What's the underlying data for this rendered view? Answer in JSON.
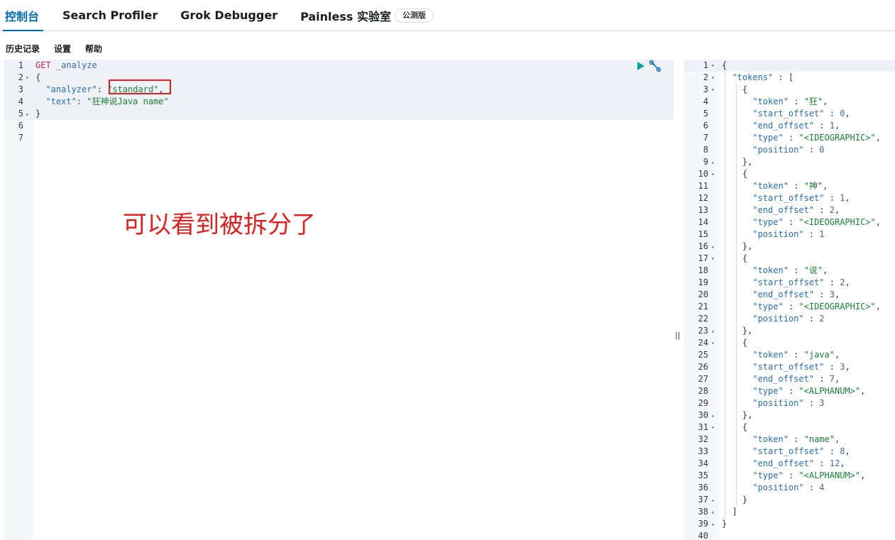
{
  "tabs": [
    {
      "label": "控制台",
      "active": true
    },
    {
      "label": "Search Profiler"
    },
    {
      "label": "Grok Debugger"
    },
    {
      "label": "Painless 实验室",
      "badge": "公测版"
    }
  ],
  "submenu": [
    "历史记录",
    "设置",
    "帮助"
  ],
  "request": {
    "lines": [
      {
        "n": "1",
        "fold": ""
      },
      {
        "n": "2",
        "fold": "▾"
      },
      {
        "n": "3",
        "fold": ""
      },
      {
        "n": "4",
        "fold": ""
      },
      {
        "n": "5",
        "fold": "▴"
      },
      {
        "n": "6",
        "fold": ""
      },
      {
        "n": "7",
        "fold": ""
      }
    ],
    "method": "GET",
    "endpoint": "_analyze",
    "analyzer_key": "\"analyzer\"",
    "analyzer_value": "\"standard\"",
    "text_key": "\"text\"",
    "text_value": "\"狂神说Java name\""
  },
  "annotation": "可以看到被拆分了",
  "response": {
    "tokens": [
      {
        "token": "\"狂\"",
        "start_offset": "0",
        "end_offset": "1",
        "type": "\"<IDEOGRAPHIC>\"",
        "position": "0"
      },
      {
        "token": "\"神\"",
        "start_offset": "1",
        "end_offset": "2",
        "type": "\"<IDEOGRAPHIC>\"",
        "position": "1"
      },
      {
        "token": "\"说\"",
        "start_offset": "2",
        "end_offset": "3",
        "type": "\"<IDEOGRAPHIC>\"",
        "position": "2"
      },
      {
        "token": "\"java\"",
        "start_offset": "3",
        "end_offset": "7",
        "type": "\"<ALPHANUM>\"",
        "position": "3"
      },
      {
        "token": "\"name\"",
        "start_offset": "8",
        "end_offset": "12",
        "type": "\"<ALPHANUM>\"",
        "position": "4"
      }
    ],
    "last_line_number": "40"
  },
  "colors": {
    "accent": "#006bb4",
    "play": "#00a69b",
    "annotation": "#e02020"
  },
  "icons": {
    "run": "play-icon",
    "settings": "wrench-icon",
    "resize": "pane-resizer"
  }
}
